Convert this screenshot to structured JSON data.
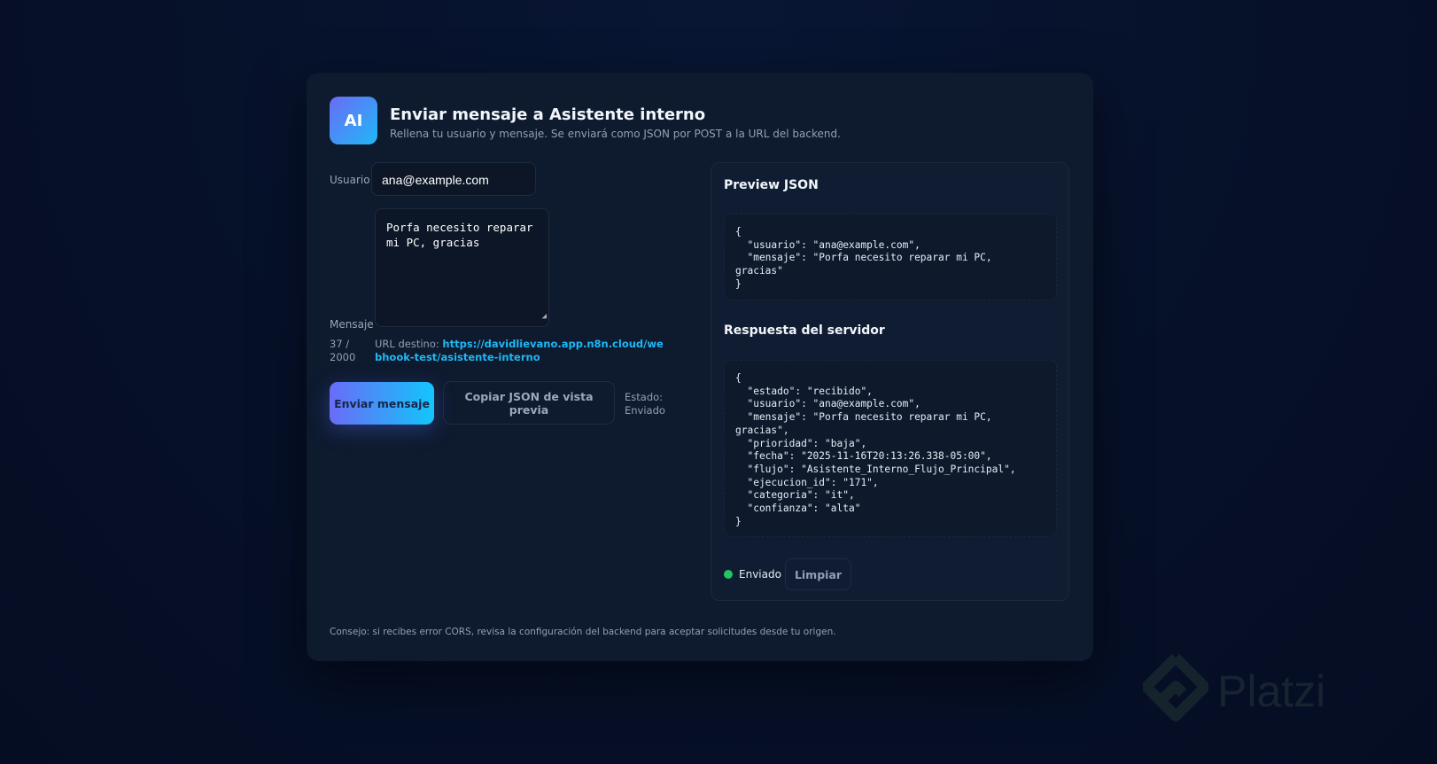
{
  "header": {
    "logo": "AI",
    "title": "Enviar mensaje a Asistente interno",
    "subtitle": "Rellena tu usuario y mensaje. Se enviará como JSON por POST a la URL del backend."
  },
  "form": {
    "usuario_label": "Usuario",
    "usuario_value": "ana@example.com",
    "mensaje_label": "Mensaje",
    "mensaje_value": "Porfa necesito reparar\nmi PC, gracias",
    "counter": "37 / 2000",
    "url_label": "URL destino:",
    "url": "https://davidlievano.app.n8n.cloud/webhook-test/asistente-interno",
    "send_label": "Enviar mensaje",
    "copy_label": "Copiar JSON de vista previa",
    "estado": "Estado: Enviado"
  },
  "panel": {
    "preview_title": "Preview JSON",
    "preview_json": "{\n  \"usuario\": \"ana@example.com\",\n  \"mensaje\": \"Porfa necesito reparar mi PC,\ngracias\"\n}",
    "response_title": "Respuesta del servidor",
    "response_json": "{\n  \"estado\": \"recibido\",\n  \"usuario\": \"ana@example.com\",\n  \"mensaje\": \"Porfa necesito reparar mi PC,\ngracias\",\n  \"prioridad\": \"baja\",\n  \"fecha\": \"2025-11-16T20:13:26.338-05:00\",\n  \"flujo\": \"Asistente_Interno_Flujo_Principal\",\n  \"ejecucion_id\": \"171\",\n  \"categoria\": \"it\",\n  \"confianza\": \"alta\"\n}",
    "status": "Enviado",
    "status_color": "#22c55e",
    "clear_label": "Limpiar"
  },
  "tip": "Consejo: si recibes error CORS, revisa la configuración del backend para aceptar solicitudes desde tu origen.",
  "watermark": "Platzi"
}
